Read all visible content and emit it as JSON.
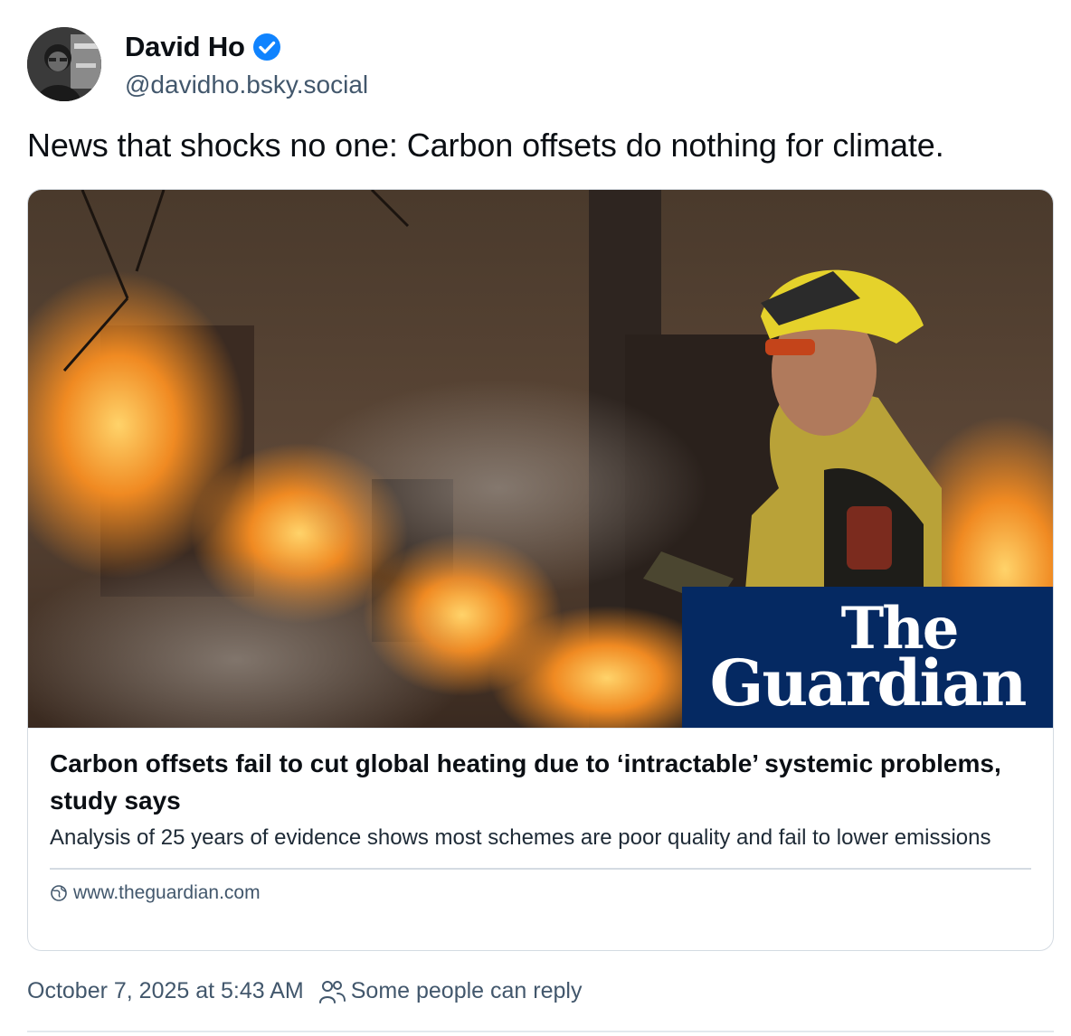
{
  "author": {
    "display_name": "David Ho",
    "handle": "@davidho.bsky.social",
    "verified": true
  },
  "post": {
    "text": "News that shocks no one: Carbon offsets do nothing for climate."
  },
  "link_card": {
    "brand_line1": "The",
    "brand_line2": "Guardian",
    "title": "Carbon offsets fail to cut global heating due to ‘intractable’ systemic problems, study says",
    "description": "Analysis of 25 years of evidence shows most schemes are poor quality and fail to lower emissions",
    "domain": "www.theguardian.com",
    "domain_icon": "globe-icon"
  },
  "meta": {
    "timestamp": "October 7, 2025 at 5:43 AM",
    "reply_setting": "Some people can reply",
    "reply_icon": "people-icon"
  },
  "colors": {
    "verified_blue": "#1083fe",
    "guardian_navy": "#052962",
    "muted_text": "#42576c",
    "border": "#d4dbe2"
  }
}
